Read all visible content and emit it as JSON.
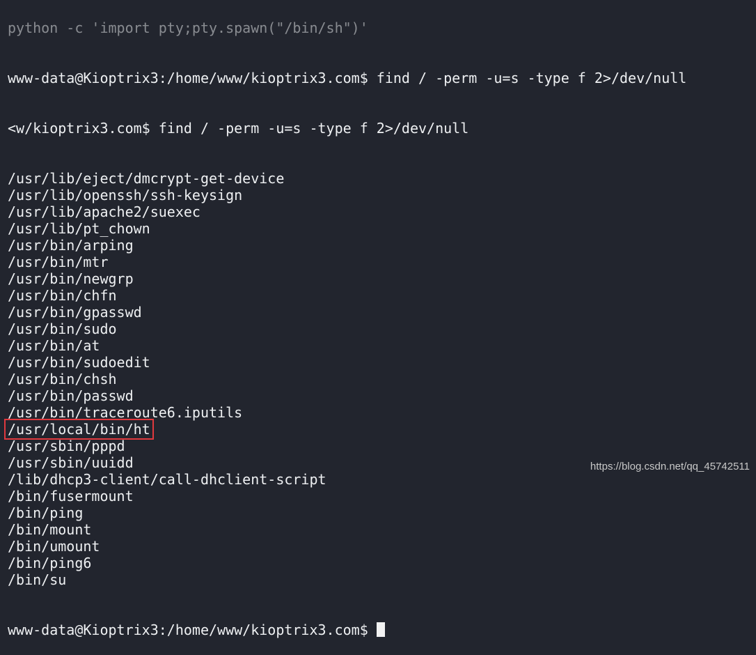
{
  "terminal": {
    "partial_top_line": "python -c 'import pty;pty.spawn(\"/bin/sh\")'",
    "command_line": "www-data@Kioptrix3:/home/www/kioptrix3.com$ find / -perm -u=s -type f 2>/dev/null",
    "echo_line": "<w/kioptrix3.com$ find / -perm -u=s -type f 2>/dev/null",
    "results": [
      "/usr/lib/eject/dmcrypt-get-device",
      "/usr/lib/openssh/ssh-keysign",
      "/usr/lib/apache2/suexec",
      "/usr/lib/pt_chown",
      "/usr/bin/arping",
      "/usr/bin/mtr",
      "/usr/bin/newgrp",
      "/usr/bin/chfn",
      "/usr/bin/gpasswd",
      "/usr/bin/sudo",
      "/usr/bin/at",
      "/usr/bin/sudoedit",
      "/usr/bin/chsh",
      "/usr/bin/passwd",
      "/usr/bin/traceroute6.iputils",
      "/usr/local/bin/ht",
      "/usr/sbin/pppd",
      "/usr/sbin/uuidd",
      "/lib/dhcp3-client/call-dhclient-script",
      "/bin/fusermount",
      "/bin/ping",
      "/bin/mount",
      "/bin/umount",
      "/bin/ping6",
      "/bin/su"
    ],
    "highlighted_index": 15,
    "prompt": "www-data@Kioptrix3:/home/www/kioptrix3.com$ "
  },
  "watermark": "https://blog.csdn.net/qq_45742511",
  "colors": {
    "background": "#22252e",
    "text": "#eef0f2",
    "highlight_box": "#e0393e"
  }
}
